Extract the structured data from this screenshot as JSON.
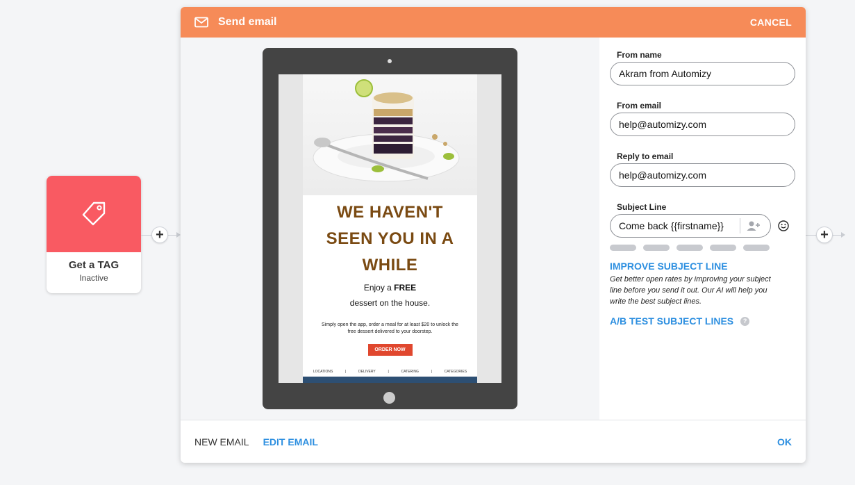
{
  "trigger": {
    "title": "Get a TAG",
    "status": "Inactive",
    "icon": "tag-icon",
    "color": "#f95a62"
  },
  "modal": {
    "title": "Send email",
    "cancel_label": "CANCEL",
    "header_color": "#f68b58",
    "header_icon": "envelope-icon"
  },
  "email_preview": {
    "headline_lines": [
      "WE HAVEN'T",
      "SEEN YOU IN A",
      "WHILE"
    ],
    "offer_prefix": "Enjoy a ",
    "offer_bold": "FREE",
    "offer_line2": "dessert on the house.",
    "body": "Simply open the app, order a meal for at least $20 to unlock the free dessert delivered to your doorstep.",
    "cta": "ORDER NOW",
    "nav": [
      "LOCATIONS",
      "|",
      "DELIVERY",
      "|",
      "CATERING",
      "|",
      "CATEGORIES"
    ]
  },
  "form": {
    "from_name": {
      "label": "From name",
      "value": "Akram from Automizy"
    },
    "from_email": {
      "label": "From email",
      "value": "help@automizy.com"
    },
    "reply_email": {
      "label": "Reply to email",
      "value": "help@automizy.com"
    },
    "subject": {
      "label": "Subject Line",
      "value": "Come back {{firstname}}"
    },
    "improve_title": "IMPROVE SUBJECT LINE",
    "improve_desc": "Get better open rates by improving your subject line before you send it out. Our AI will help you write the best subject lines.",
    "abtest_label": "A/B TEST SUBJECT LINES"
  },
  "footer": {
    "new_email": "NEW EMAIL",
    "edit_email": "EDIT EMAIL",
    "ok": "OK"
  },
  "colors": {
    "accent": "#2d8fe0",
    "headline": "#7a4a12",
    "cta": "#e0472e"
  }
}
